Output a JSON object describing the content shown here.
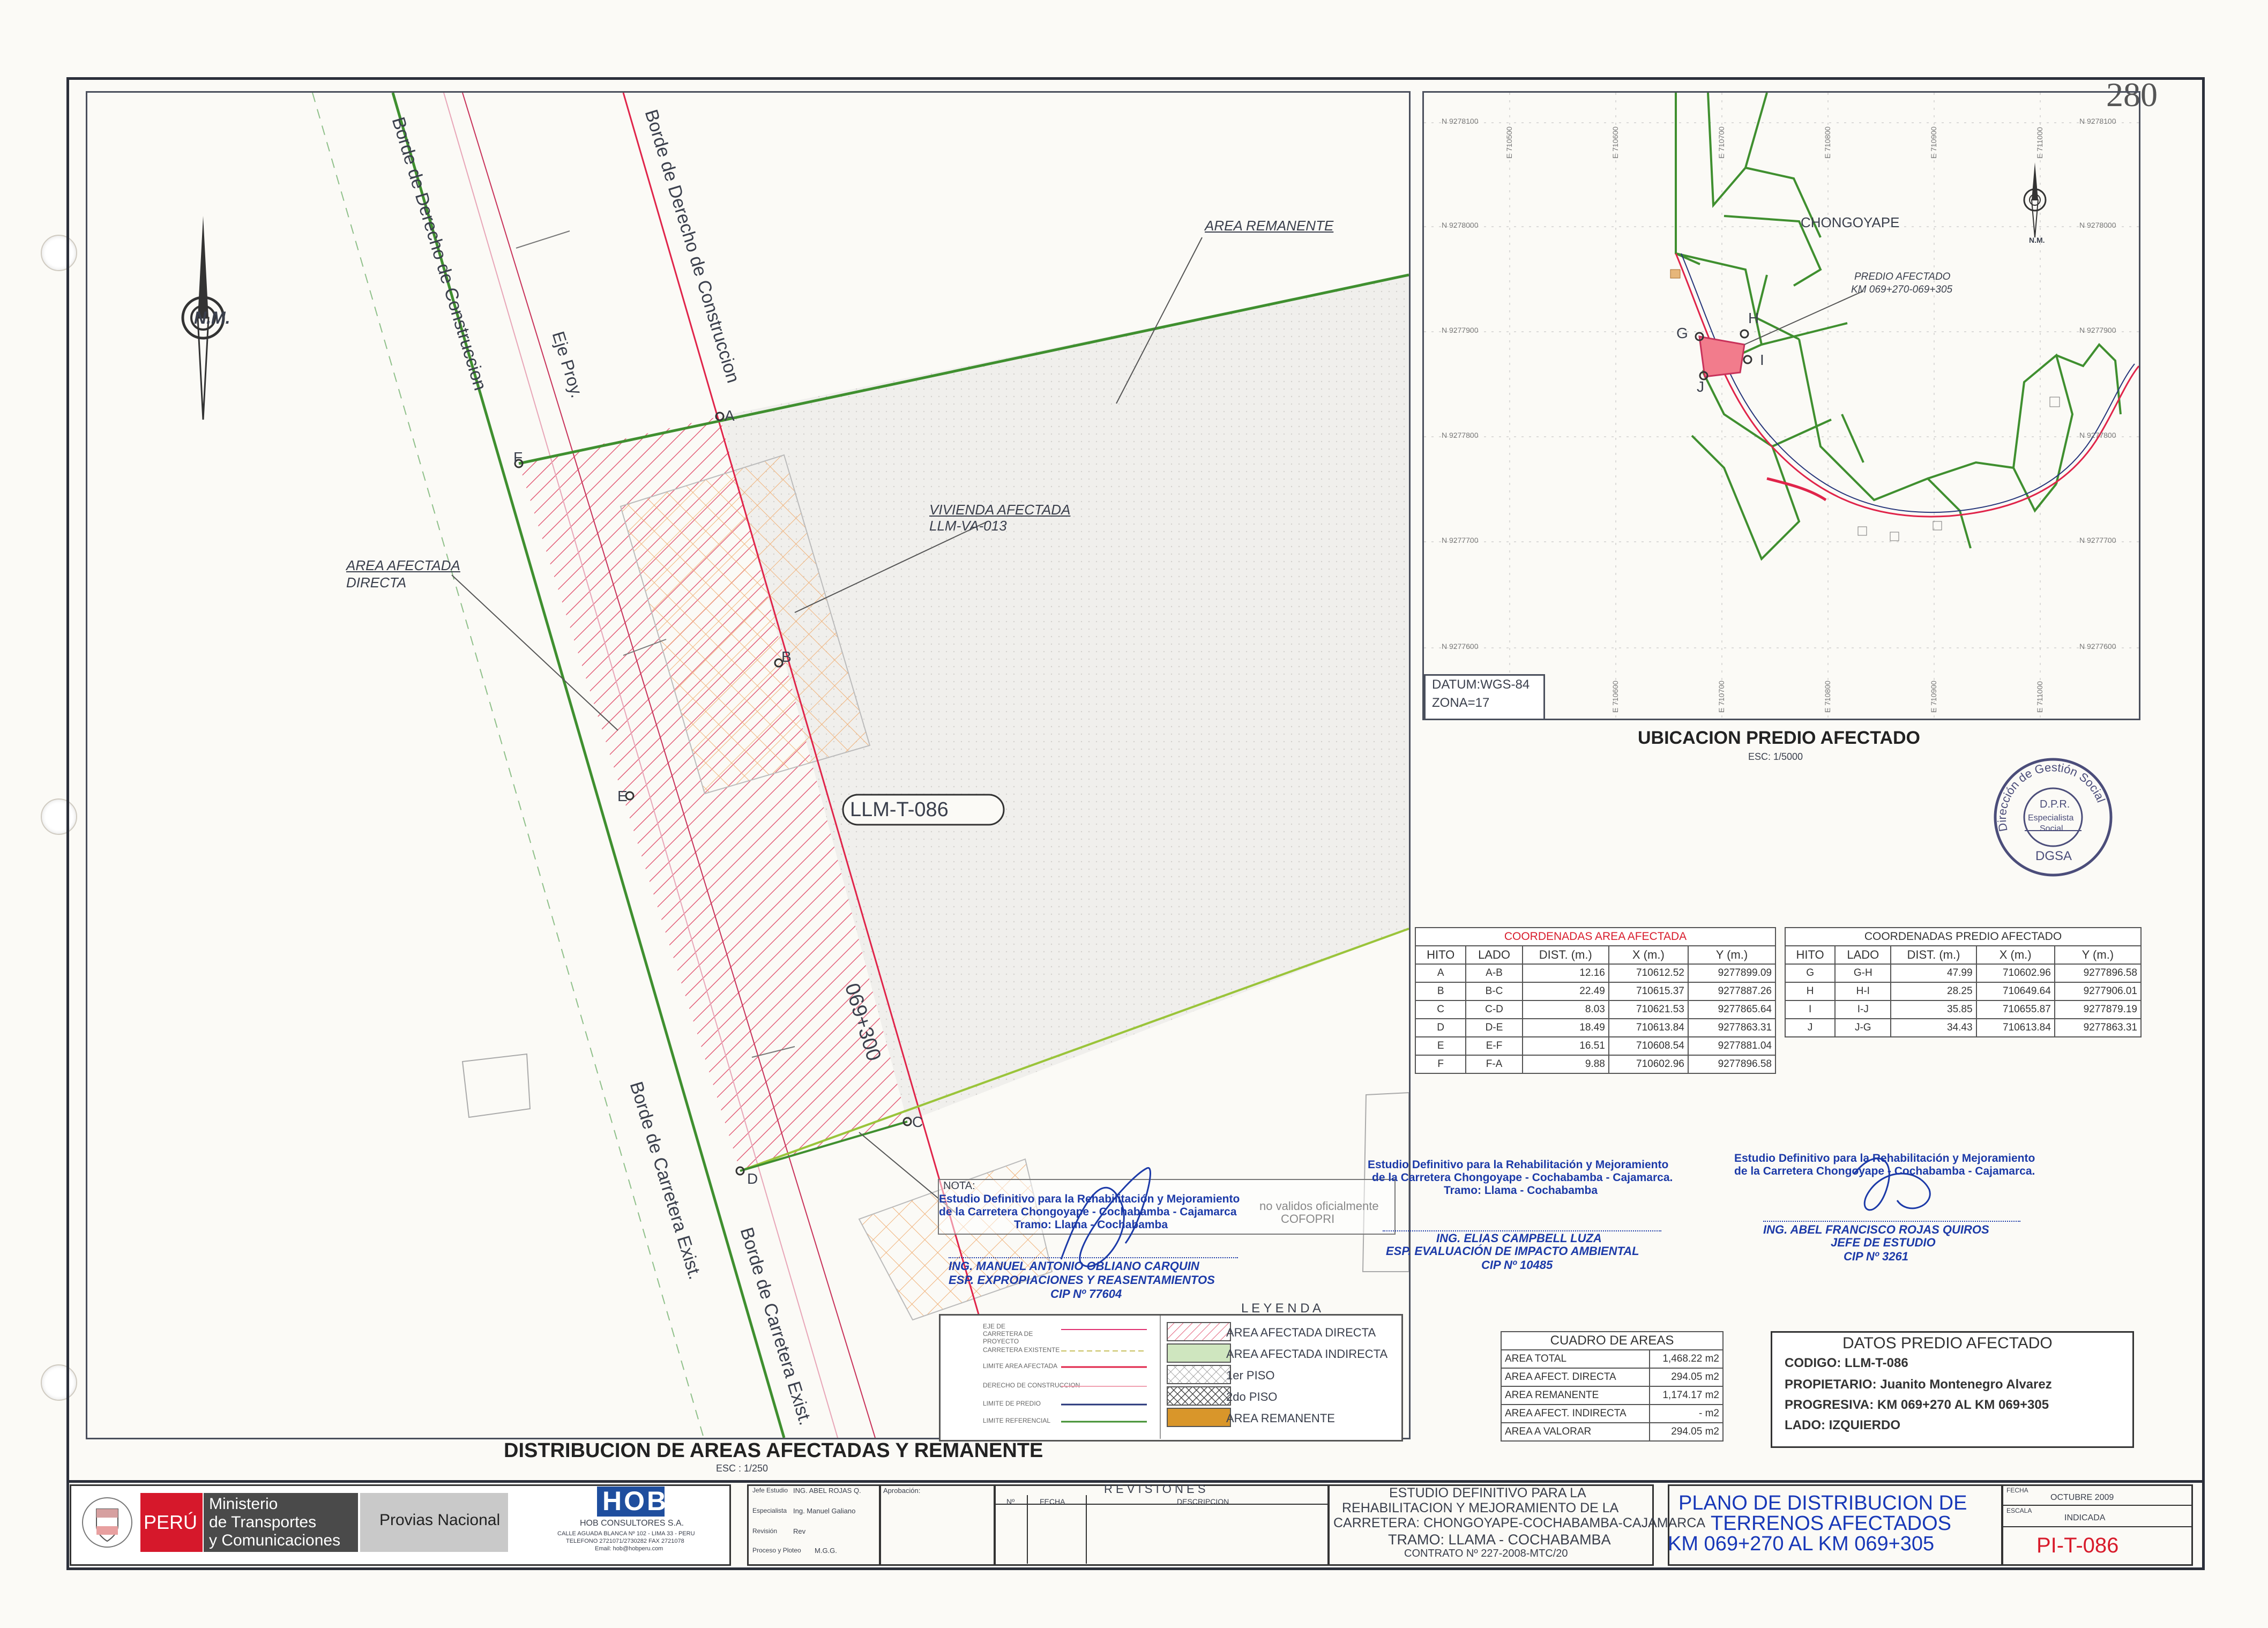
{
  "sheet_number": "280",
  "north_label": "N.M.",
  "inset_north_label": "N.M.",
  "plan": {
    "road_labels": {
      "borde_derecho_izq": "Borde de Derecho de Construccion",
      "eje_proy": "Eje Proy.",
      "borde_derecho_der": "Borde de Derecho de Construccion",
      "borde_carretera_izq": "Borde de Carretera Exist.",
      "borde_carretera_der": "Borde de Carretera Exist."
    },
    "area_remanente": "AREA REMANENTE",
    "vivienda_afectada": "VIVIENDA AFECTADA",
    "vivienda_code": "LLM-VA-013",
    "area_afectada_1": "AREA AFECTADA",
    "area_afectada_2": "DIRECTA",
    "parcel_code": "LLM-T-086",
    "progresiva": "069+300",
    "points": {
      "A": "A",
      "B": "B",
      "C": "C",
      "D": "D",
      "E": "E",
      "F": "F"
    },
    "title": "DISTRIBUCION DE AREAS AFECTADAS Y REMANENTE",
    "scale": "ESC : 1/250"
  },
  "nota": {
    "header": "NOTA:",
    "text_1": "no validos oficialmente",
    "text_2": "COFOPRI"
  },
  "inset": {
    "place": "CHONGOYAPE",
    "predio_label_1": "PREDIO AFECTADO",
    "predio_label_2": "KM 069+270-069+305",
    "points": {
      "G": "G",
      "H": "H",
      "I": "I",
      "J": "J"
    },
    "north_coords": [
      "N 9278100",
      "N 9278000",
      "N 9277900",
      "N 9277800",
      "N 9277700",
      "N 9277600"
    ],
    "east_coords": [
      "E 710500",
      "E 710600",
      "E 710700",
      "E 710800",
      "E 710900",
      "E 711000"
    ],
    "datum": "DATUM:WGS-84",
    "zona": "ZONA=17",
    "title": "UBICACION PREDIO AFECTADO",
    "scale": "ESC: 1/5000"
  },
  "seal": {
    "ring_text": "Dirección de Gestión Social",
    "center_1": "D.P.R.",
    "center_2": "Especialista",
    "center_3": "Social",
    "bottom": "DGSA"
  },
  "coords_area": {
    "title": "COORDENADAS AREA AFECTADA",
    "headers": [
      "HITO",
      "LADO",
      "DIST. (m.)",
      "X (m.)",
      "Y (m.)"
    ],
    "rows": [
      [
        "A",
        "A-B",
        "12.16",
        "710612.52",
        "9277899.09"
      ],
      [
        "B",
        "B-C",
        "22.49",
        "710615.37",
        "9277887.26"
      ],
      [
        "C",
        "C-D",
        "8.03",
        "710621.53",
        "9277865.64"
      ],
      [
        "D",
        "D-E",
        "18.49",
        "710613.84",
        "9277863.31"
      ],
      [
        "E",
        "E-F",
        "16.51",
        "710608.54",
        "9277881.04"
      ],
      [
        "F",
        "F-A",
        "9.88",
        "710602.96",
        "9277896.58"
      ]
    ]
  },
  "coords_predio": {
    "title": "COORDENADAS PREDIO AFECTADO",
    "headers": [
      "HITO",
      "LADO",
      "DIST. (m.)",
      "X (m.)",
      "Y (m.)"
    ],
    "rows": [
      [
        "G",
        "G-H",
        "47.99",
        "710602.96",
        "9277896.58"
      ],
      [
        "H",
        "H-I",
        "28.25",
        "710649.64",
        "9277906.01"
      ],
      [
        "I",
        "I-J",
        "35.85",
        "710655.87",
        "9277879.19"
      ],
      [
        "J",
        "J-G",
        "34.43",
        "710613.84",
        "9277863.31"
      ]
    ]
  },
  "cuadro_areas": {
    "title": "CUADRO DE AREAS",
    "rows": [
      [
        "AREA TOTAL",
        "1,468.22 m2"
      ],
      [
        "AREA AFECT. DIRECTA",
        "294.05 m2"
      ],
      [
        "AREA REMANENTE",
        "1,174.17 m2"
      ],
      [
        "AREA AFECT. INDIRECTA",
        "- m2"
      ],
      [
        "AREA A VALORAR",
        "294.05 m2"
      ]
    ]
  },
  "datos_predio": {
    "title": "DATOS PREDIO AFECTADO",
    "codigo": "CODIGO: LLM-T-086",
    "propietario": "PROPIETARIO: Juanito Montenegro Alvarez",
    "progresiva": "PROGRESIVA: KM 069+270 AL KM 069+305",
    "lado": "LADO: IZQUIERDO"
  },
  "leyenda": {
    "title": "L E Y E N D A",
    "lines": [
      "EJE DE CARRETERA DE PROYECTO",
      "CARRETERA EXISTENTE",
      "LIMITE AREA AFECTADA",
      "DERECHO DE CONSTRUCCION",
      "LIMITE DE PREDIO",
      "LIMITE REFERENCIAL"
    ],
    "fills": [
      "AREA AFECTADA DIRECTA",
      "AREA AFECTADA INDIRECTA",
      "1er PISO",
      "2do PISO",
      "AREA REMANENTE"
    ]
  },
  "stamps": {
    "s1_l1": "Estudio Definitivo para la Rehabilitación y Mejoramiento",
    "s1_l2": "de la Carretera Chongoyape - Cochabamba - Cajamarca",
    "s1_l3": "Tramo: Llama - Cochabamba",
    "s1_name": "ING. MANUEL ANTONIO OBLIANO CARQUIN",
    "s1_role": "ESP. EXPROPIACIONES Y REASENTAMIENTOS",
    "s1_cip": "CIP Nº 77604",
    "s2_l1": "Estudio Definitivo para la Rehabilitación y Mejoramiento",
    "s2_l2": "de la Carretera Chongoyape - Cochabamba - Cajamarca.",
    "s2_l3": "Tramo: Llama - Cochabamba",
    "s2_name": "ING. ELIAS CAMPBELL LUZA",
    "s2_role": "ESP. EVALUACIÓN DE IMPACTO AMBIENTAL",
    "s2_cip": "CIP Nº 10485",
    "s3_l1": "Estudio Definitivo para la Rehabilitación y Mejoramiento",
    "s3_l2": "de la Carretera Chongoyape - Cochabamba - Cajamarca.",
    "s3_name": "ING. ABEL FRANCISCO ROJAS QUIROS",
    "s3_role": "JEFE DE ESTUDIO",
    "s3_cip": "CIP Nº 3261"
  },
  "title_block": {
    "peru": "PERÚ",
    "ministerio_1": "Ministerio",
    "ministerio_2": "de Transportes",
    "ministerio_3": "y Comunicaciones",
    "provias": "Provias Nacional",
    "hob_logo": "HOB",
    "hob_name": "HOB CONSULTORES S.A.",
    "hob_addr_1": "CALLE AGUADA BLANCA Nº 102 - LIMA 33 - PERU",
    "hob_addr_2": "TELEFONO 2721071/2730282 FAX 2721078",
    "hob_addr_3": "Email: hob@hobperu.com",
    "jefe_label": "Jefe Estudio",
    "jefe_val": "ING. ABEL ROJAS Q.",
    "esp_label": "Especialista",
    "esp_val": "Ing. Manuel Galiano",
    "rev_label": "Revisión",
    "rev_val": "Rev",
    "proc_label": "Proceso y Ploteo",
    "proc_val": "M.G.G.",
    "aprob_label": "Aprobación:",
    "revisiones": "R E V I S I O N E S",
    "rev_cols": [
      "Nº",
      "FECHA",
      "DESCRIPCION"
    ],
    "estudio_1": "ESTUDIO DEFINITIVO PARA LA",
    "estudio_2": "REHABILITACION Y MEJORAMIENTO DE LA",
    "estudio_3": "CARRETERA: CHONGOYAPE-COCHABAMBA-CAJAMARCA",
    "estudio_4": "TRAMO: LLAMA - COCHABAMBA",
    "contrato": "CONTRATO Nº 227-2008-MTC/20",
    "plano_1": "PLANO DE DISTRIBUCION DE",
    "plano_2": "TERRENOS AFECTADOS",
    "plano_3": "KM 069+270 AL KM 069+305",
    "fecha_label": "FECHA",
    "fecha_val": "OCTUBRE 2009",
    "escala_label": "ESCALA",
    "escala_val": "INDICADA",
    "plano_code": "PI-T-086"
  },
  "colors": {
    "paper": "#fbfaf6",
    "frame": "#2b2f3a",
    "green_line": "#3f8f2f",
    "red_line": "#e0244a",
    "stamp_blue": "#1c3aa8",
    "title_blue": "#1838b8",
    "code_red": "#d81b2b"
  }
}
